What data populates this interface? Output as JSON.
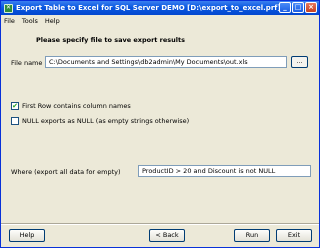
{
  "window": {
    "title": "Export Table to Excel for SQL Server DEMO [D:\\export_to_excel.prf]",
    "icon": "excel-export-icon"
  },
  "menu": [
    "File",
    "Tools",
    "Help"
  ],
  "header": {
    "title": "Please specify file to save export results"
  },
  "file": {
    "label": "File name",
    "value": "C:\\Documents and Settings\\db2admin\\My Documents\\out.xls",
    "browse_label": "..."
  },
  "options": {
    "first_row": {
      "label": "First Row contains column names",
      "checked": true
    },
    "null_exports": {
      "label": "NULL exports as NULL (as empty strings otherwise)",
      "checked": false
    }
  },
  "where": {
    "label": "Where (export all data for empty)",
    "value": "ProductID > 20 and Discount is not NULL"
  },
  "buttons": {
    "help": "Help",
    "back": "< Back",
    "run": "Run",
    "exit": "Exit"
  }
}
